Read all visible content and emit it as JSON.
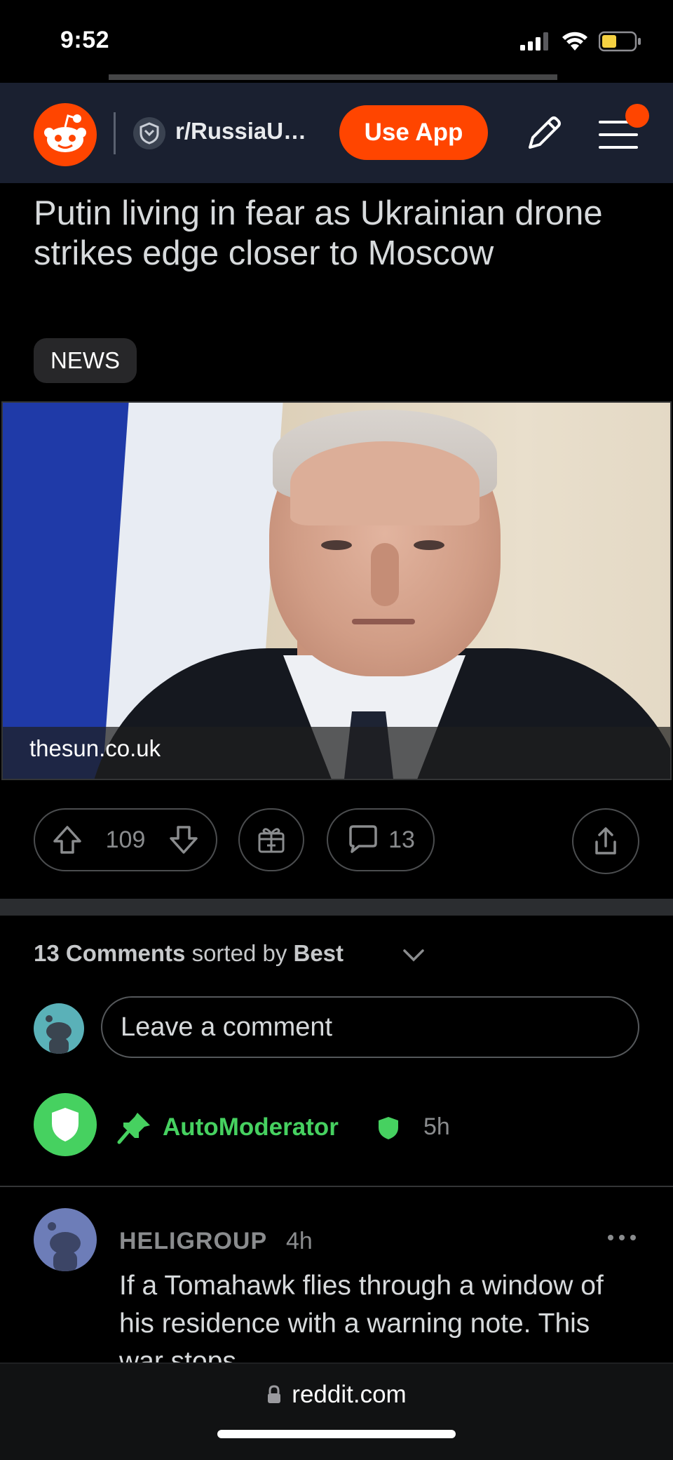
{
  "status_bar": {
    "time": "9:52"
  },
  "header": {
    "subreddit": "r/RussiaU…",
    "use_app_label": "Use App"
  },
  "post": {
    "title": "Putin living in fear as Ukrainian drone strikes edge closer to Moscow",
    "flair": "NEWS",
    "link_domain": "thesun.co.uk",
    "score": "109",
    "comment_count": "13"
  },
  "comments_section": {
    "count_label": "13 Comments",
    "sorted_by_label": "sorted by",
    "sort_value": "Best",
    "input_placeholder": "Leave a comment"
  },
  "comments": [
    {
      "author": "AutoModerator",
      "time": "5h"
    },
    {
      "author": "HELIGROUP",
      "time": "4h",
      "body": "If a Tomahawk flies through a window of his residence with a warning note. This war stops."
    }
  ],
  "browser": {
    "url": "reddit.com"
  },
  "colors": {
    "accent": "#ff4500",
    "mod_green": "#46d160",
    "header_bg": "#1a2030"
  }
}
